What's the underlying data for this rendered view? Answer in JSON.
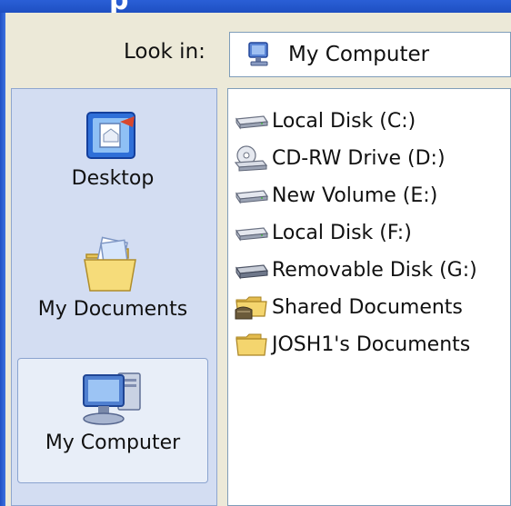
{
  "title_fragment": "p",
  "look_in": {
    "label": "Look in:",
    "value": "My Computer",
    "value_icon": "my-computer-icon"
  },
  "places": [
    {
      "label": "Desktop",
      "icon": "desktop-icon"
    },
    {
      "label": "My Documents",
      "icon": "my-documents-icon"
    },
    {
      "label": "My Computer",
      "icon": "my-computer-icon",
      "selected": true
    }
  ],
  "files": [
    {
      "label": "Local Disk (C:)",
      "icon": "hard-drive-icon"
    },
    {
      "label": "CD-RW Drive (D:)",
      "icon": "cd-drive-icon"
    },
    {
      "label": "New Volume (E:)",
      "icon": "hard-drive-icon"
    },
    {
      "label": "Local Disk (F:)",
      "icon": "hard-drive-icon"
    },
    {
      "label": "Removable Disk (G:)",
      "icon": "removable-disk-icon"
    },
    {
      "label": "Shared Documents",
      "icon": "shared-folder-icon"
    },
    {
      "label": "JOSH1's Documents",
      "icon": "folder-icon"
    }
  ]
}
